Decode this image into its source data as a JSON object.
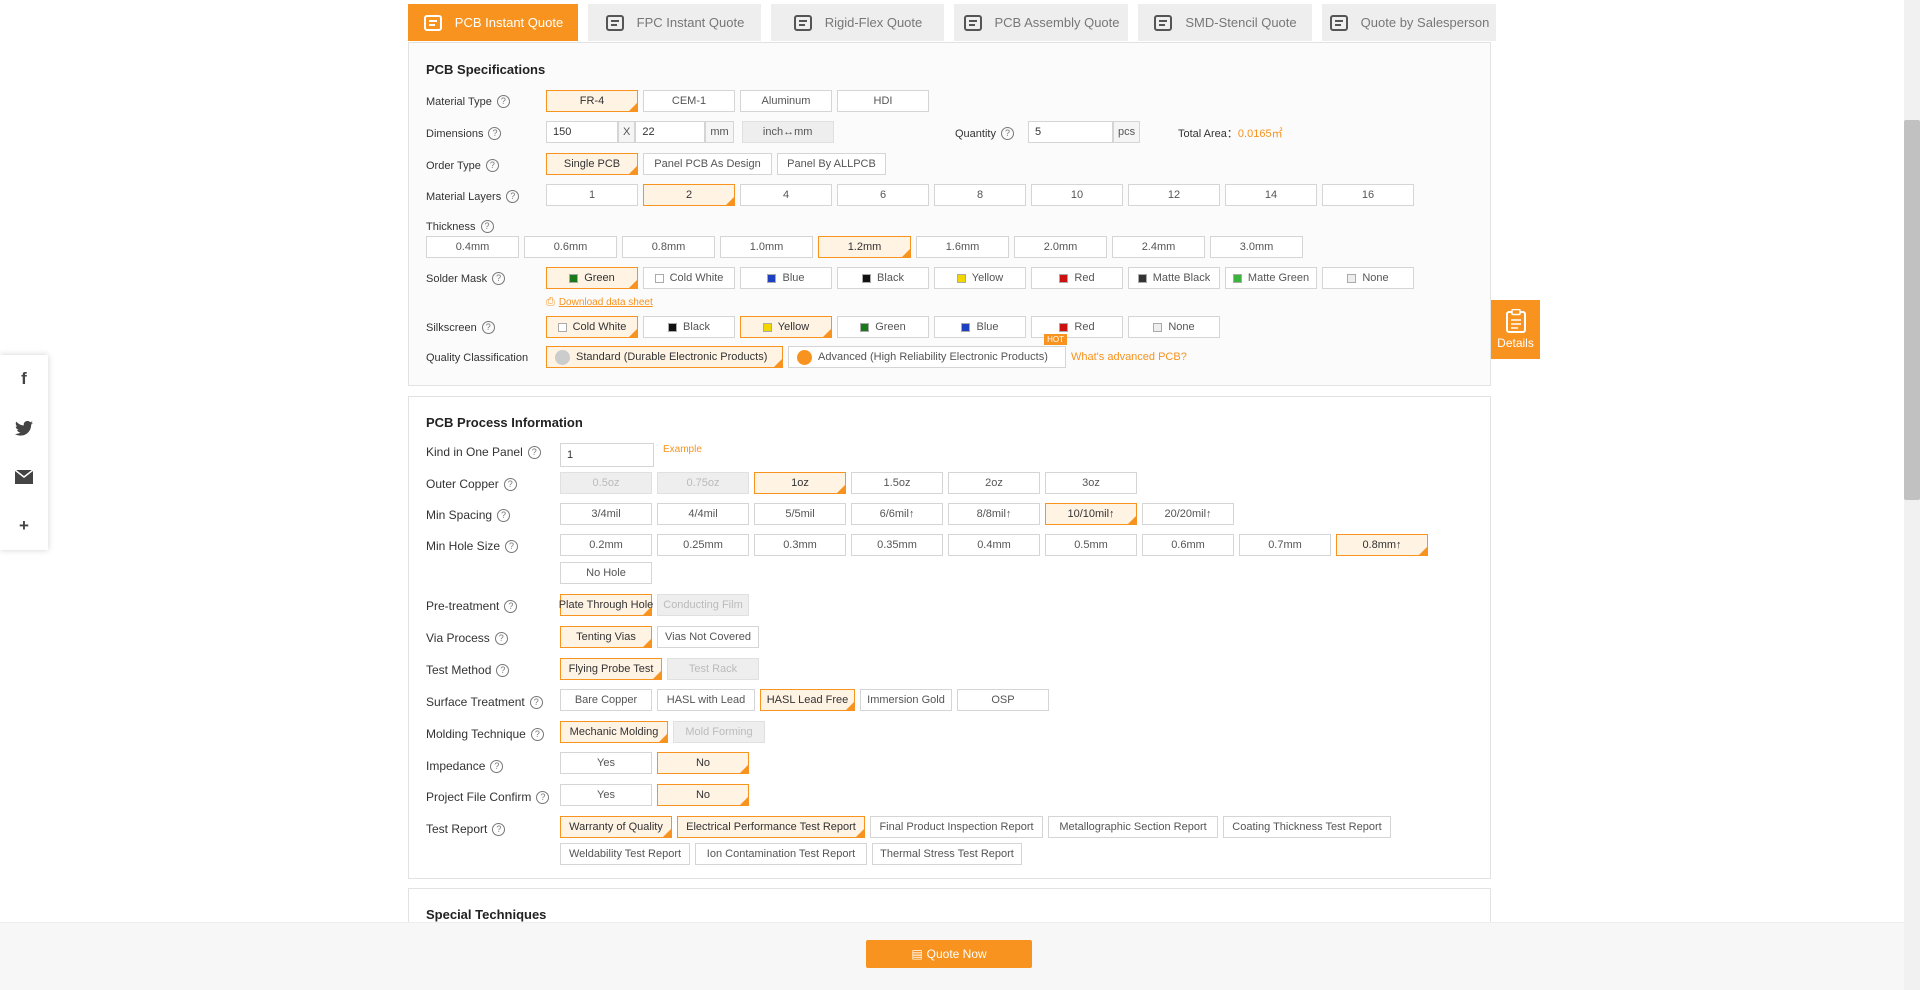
{
  "tabs": [
    {
      "label": "PCB Instant Quote",
      "icon": "pcb-icon"
    },
    {
      "label": "FPC Instant Quote",
      "icon": "fpc-icon"
    },
    {
      "label": "Rigid-Flex Quote",
      "icon": "rigid-flex-icon"
    },
    {
      "label": "PCB Assembly Quote",
      "icon": "chip-icon"
    },
    {
      "label": "SMD-Stencil Quote",
      "icon": "stencil-icon"
    },
    {
      "label": "Quote by Salesperson",
      "icon": "headset-icon"
    }
  ],
  "spec": {
    "title": "PCB Specifications",
    "material_type": {
      "label": "Material Type",
      "options": [
        "FR-4",
        "CEM-1",
        "Aluminum",
        "HDI"
      ],
      "selected": "FR-4"
    },
    "dimensions": {
      "label": "Dimensions",
      "width": "150",
      "x": "X",
      "height": "22",
      "unit": "mm",
      "toggle": "inch↔mm"
    },
    "quantity": {
      "label": "Quantity",
      "value": "5",
      "unit": "pcs"
    },
    "total_area": {
      "label": "Total Area：",
      "value": "0.0165㎡"
    },
    "order_type": {
      "label": "Order Type",
      "options": [
        "Single PCB",
        "Panel PCB As Design",
        "Panel By ALLPCB"
      ],
      "selected": "Single PCB"
    },
    "layers": {
      "label": "Material Layers",
      "options": [
        "1",
        "2",
        "4",
        "6",
        "8",
        "10",
        "12",
        "14",
        "16"
      ],
      "selected": "2"
    },
    "thickness": {
      "label": "Thickness",
      "options": [
        "0.4mm",
        "0.6mm",
        "0.8mm",
        "1.0mm",
        "1.2mm",
        "1.6mm",
        "2.0mm",
        "2.4mm",
        "3.0mm"
      ],
      "selected": "1.2mm"
    },
    "solder_mask": {
      "label": "Solder Mask",
      "options": [
        {
          "name": "Green",
          "color": "#1a7a1a"
        },
        {
          "name": "Cold White",
          "color": "#ffffff"
        },
        {
          "name": "Blue",
          "color": "#1e3fbf"
        },
        {
          "name": "Black",
          "color": "#111111"
        },
        {
          "name": "Yellow",
          "color": "#f2d600"
        },
        {
          "name": "Red",
          "color": "#cc1111"
        },
        {
          "name": "Matte Black",
          "color": "#333333"
        },
        {
          "name": "Matte Green",
          "color": "#3cb43c"
        },
        {
          "name": "None",
          "color": "#eeeeee"
        }
      ],
      "selected": "Green",
      "download": "Download data sheet"
    },
    "silkscreen": {
      "label": "Silkscreen",
      "options": [
        {
          "name": "Cold White",
          "color": "#ffffff"
        },
        {
          "name": "Black",
          "color": "#111111"
        },
        {
          "name": "Yellow",
          "color": "#f2d600"
        },
        {
          "name": "Green",
          "color": "#1a7a1a"
        },
        {
          "name": "Blue",
          "color": "#1e3fbf"
        },
        {
          "name": "Red",
          "color": "#cc1111"
        },
        {
          "name": "None",
          "color": "#eeeeee"
        }
      ],
      "selected": [
        "Cold White",
        "Yellow"
      ]
    },
    "quality": {
      "label": "Quality Classification",
      "standard": "Standard (Durable Electronic Products)",
      "advanced": "Advanced (High Reliability Electronic Products)",
      "badge": "HOT",
      "link": "What's advanced PCB?"
    }
  },
  "process": {
    "title": "PCB Process Information",
    "kind": {
      "label": "Kind in One Panel",
      "value": "1",
      "example": "Example"
    },
    "outer_copper": {
      "label": "Outer Copper",
      "options": [
        "0.5oz",
        "0.75oz",
        "1oz",
        "1.5oz",
        "2oz",
        "3oz"
      ],
      "selected": "1oz",
      "disabled": [
        "0.5oz",
        "0.75oz"
      ]
    },
    "min_spacing": {
      "label": "Min Spacing",
      "options": [
        "3/4mil",
        "4/4mil",
        "5/5mil",
        "6/6mil↑",
        "8/8mil↑",
        "10/10mil↑",
        "20/20mil↑"
      ],
      "selected": "10/10mil↑"
    },
    "min_hole": {
      "label": "Min Hole Size",
      "options": [
        "0.2mm",
        "0.25mm",
        "0.3mm",
        "0.35mm",
        "0.4mm",
        "0.5mm",
        "0.6mm",
        "0.7mm",
        "0.8mm↑",
        "No Hole"
      ],
      "selected": "0.8mm↑"
    },
    "pretreatment": {
      "label": "Pre-treatment",
      "options": [
        "Plate Through Hole",
        "Conducting Film"
      ],
      "selected": "Plate Through Hole",
      "disabled": [
        "Conducting Film"
      ]
    },
    "via": {
      "label": "Via Process",
      "options": [
        "Tenting Vias",
        "Vias Not Covered"
      ],
      "selected": "Tenting Vias"
    },
    "test": {
      "label": "Test Method",
      "options": [
        "Flying Probe Test",
        "Test Rack"
      ],
      "selected": "Flying Probe Test",
      "disabled": [
        "Test Rack"
      ]
    },
    "surface": {
      "label": "Surface Treatment",
      "options": [
        "Bare Copper",
        "HASL with Lead",
        "HASL Lead Free",
        "Immersion Gold",
        "OSP"
      ],
      "selected": "HASL Lead Free"
    },
    "molding": {
      "label": "Molding Technique",
      "options": [
        "Mechanic Molding",
        "Mold Forming"
      ],
      "selected": "Mechanic Molding",
      "disabled": [
        "Mold Forming"
      ]
    },
    "impedance": {
      "label": "Impedance",
      "options": [
        "Yes",
        "No"
      ],
      "selected": "No"
    },
    "project_confirm": {
      "label": "Project File Confirm",
      "options": [
        "Yes",
        "No"
      ],
      "selected": "No"
    },
    "test_report": {
      "label": "Test Report",
      "options": [
        "Warranty of Quality",
        "Electrical Performance Test Report",
        "Final Product Inspection Report",
        "Metallographic Section Report",
        "Coating Thickness Test Report",
        "Weldability Test Report",
        "Ion Contamination Test Report",
        "Thermal Stress Test Report"
      ],
      "selected": [
        "Warranty of Quality",
        "Electrical Performance Test Report"
      ]
    }
  },
  "special": {
    "title": "Special Techniques"
  },
  "details_label": "Details",
  "quote_button": "Quote Now",
  "social": [
    "facebook-icon",
    "twitter-icon",
    "email-icon",
    "plus-icon"
  ]
}
